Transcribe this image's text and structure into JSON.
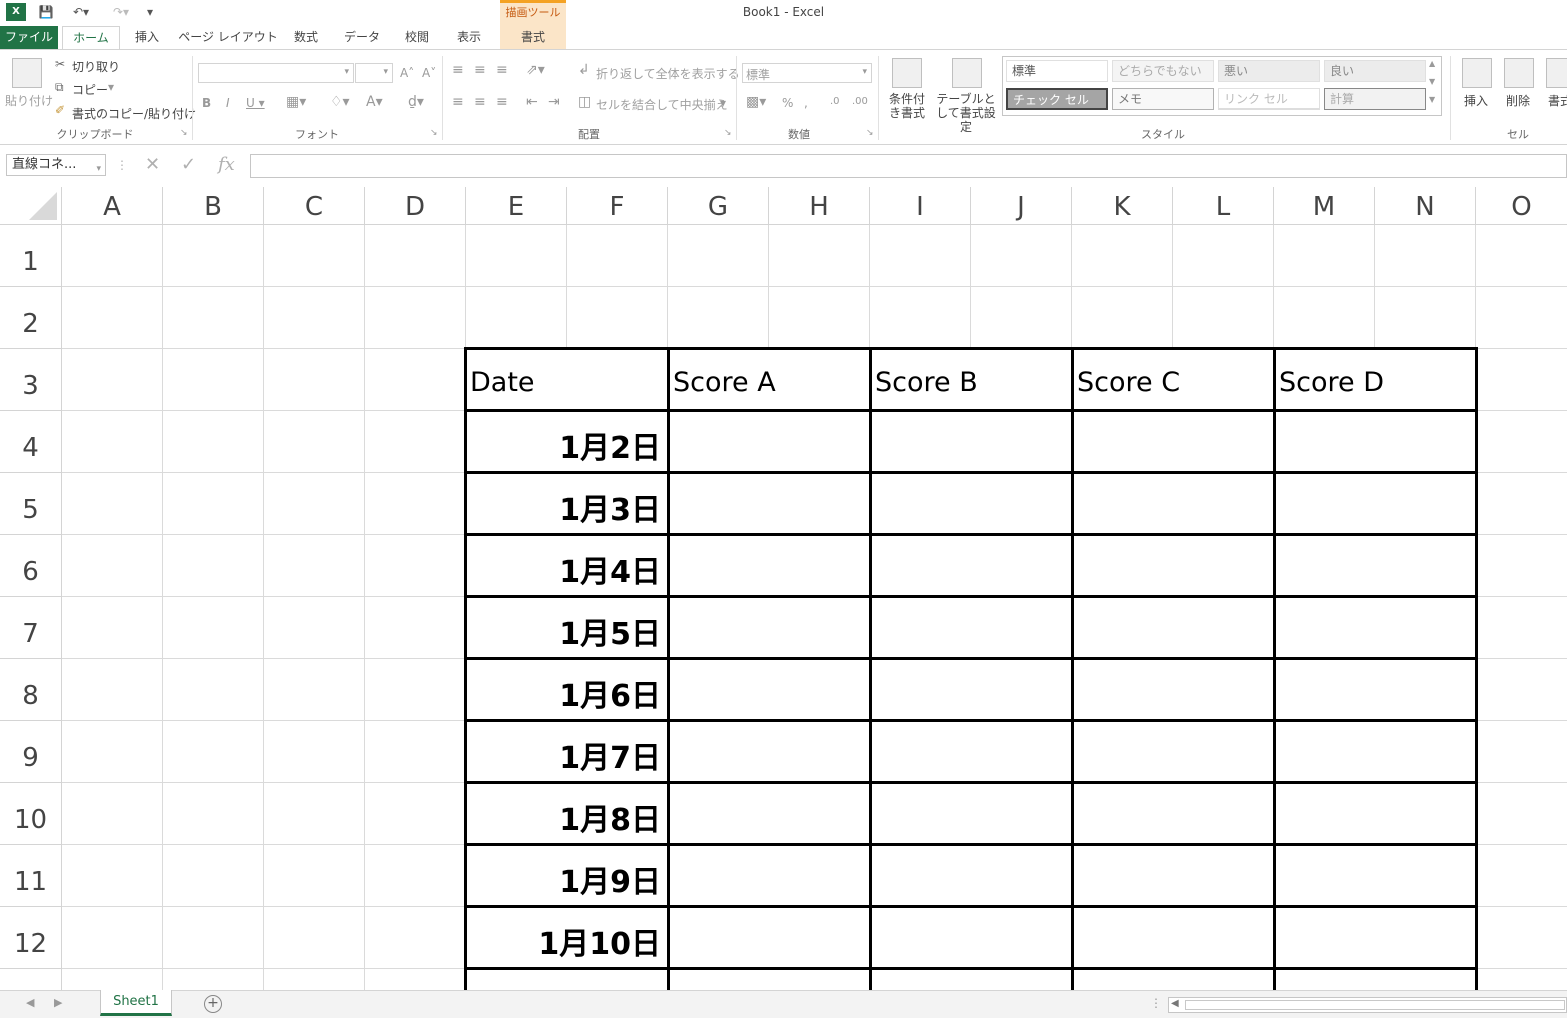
{
  "window": {
    "title": "Book1 - Excel",
    "contextual_group": "描画ツール"
  },
  "tabs": [
    {
      "label": "ファイル"
    },
    {
      "label": "ホーム"
    },
    {
      "label": "挿入"
    },
    {
      "label": "ページ レイアウト"
    },
    {
      "label": "数式"
    },
    {
      "label": "データ"
    },
    {
      "label": "校閲"
    },
    {
      "label": "表示"
    },
    {
      "label": "書式"
    }
  ],
  "ribbon": {
    "clipboard": {
      "paste": "貼り付け",
      "cut": "切り取り",
      "copy": "コピー",
      "format_painter": "書式のコピー/貼り付け",
      "group_label": "クリップボード"
    },
    "font": {
      "group_label": "フォント"
    },
    "alignment": {
      "wrap_text": "折り返して全体を表示する",
      "merge_center": "セルを結合して中央揃え",
      "group_label": "配置"
    },
    "number": {
      "format": "標準",
      "group_label": "数値"
    },
    "styles": {
      "conditional_formatting": "条件付き書式",
      "format_as_table": "テーブルとして書式設定",
      "cells": [
        "標準",
        "どちらでもない",
        "悪い",
        "良い",
        "チェック セル",
        "メモ",
        "リンク セル",
        "計算"
      ],
      "group_label": "スタイル"
    },
    "cells": {
      "insert": "挿入",
      "delete": "削除",
      "format": "書式",
      "group_label": "セル"
    }
  },
  "formula_bar": {
    "name_box": "直線コネ..."
  },
  "grid": {
    "columns": [
      "A",
      "B",
      "C",
      "D",
      "E",
      "F",
      "G",
      "H",
      "I",
      "J",
      "K",
      "L",
      "M",
      "N",
      "O"
    ],
    "rows": [
      "1",
      "2",
      "3",
      "4",
      "5",
      "6",
      "7",
      "8",
      "9",
      "10",
      "11",
      "12"
    ]
  },
  "table": {
    "headers": [
      "Date",
      "Score A",
      "Score B",
      "Score C",
      "Score D"
    ],
    "dates": [
      "1月2日",
      "1月3日",
      "1月4日",
      "1月5日",
      "1月6日",
      "1月7日",
      "1月8日",
      "1月9日",
      "1月10日"
    ]
  },
  "sheets": {
    "active": "Sheet1"
  },
  "colors": {
    "excel_green": "#217346",
    "context_orange": "#f4a223"
  }
}
